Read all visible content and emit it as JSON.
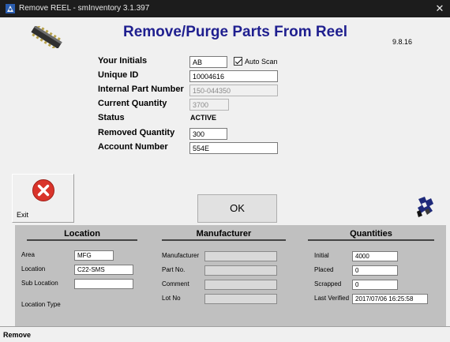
{
  "window": {
    "title": "Remove REEL - smInventory 3.1.397",
    "close_glyph": "✕"
  },
  "heading": "Remove/Purge Parts From Reel",
  "version": "9.8.16",
  "form": {
    "initials_label": "Your Initials",
    "initials_value": "AB",
    "auto_scan_label": "Auto Scan",
    "auto_scan_checked": true,
    "unique_id_label": "Unique ID",
    "unique_id_value": "10004616",
    "internal_pn_label": "Internal Part Number",
    "internal_pn_value": "150-044350",
    "current_qty_label": "Current Quantity",
    "current_qty_value": "3700",
    "status_label": "Status",
    "status_value": "ACTIVE",
    "removed_qty_label": "Removed Quantity",
    "removed_qty_value": "300",
    "account_label": "Account Number",
    "account_value": "554E"
  },
  "buttons": {
    "exit_label": "Exit",
    "ok_label": "OK"
  },
  "location": {
    "header": "Location",
    "area_label": "Area",
    "area_value": "MFG",
    "location_label": "Location",
    "location_value": "C22-SMS",
    "sub_location_label": "Sub Location",
    "sub_location_value": "",
    "location_type_label": "Location Type"
  },
  "manufacturer": {
    "header": "Manufacturer",
    "manufacturer_label": "Manufacturer",
    "manufacturer_value": "",
    "part_no_label": "Part No.",
    "part_no_value": "",
    "comment_label": "Comment",
    "comment_value": "",
    "lot_no_label": "Lot No",
    "lot_no_value": ""
  },
  "quantities": {
    "header": "Quantities",
    "initial_label": "Initial",
    "initial_value": "4000",
    "placed_label": "Placed",
    "placed_value": "0",
    "scrapped_label": "Scrapped",
    "scrapped_value": "0",
    "last_verified_label": "Last Verified",
    "last_verified_value": "2017/07/06 16:25:58"
  },
  "statusbar": {
    "text": "Remove"
  },
  "icons": {
    "app": "reel-app-icon",
    "reel": "smd-reel-icon",
    "exit": "close-circle-icon",
    "puzzle": "puzzle-icon"
  },
  "colors": {
    "heading": "#1f1f8f",
    "exit_red": "#d9342b",
    "panel": "#c0c0c0",
    "titlebar": "#1c1c1c"
  }
}
